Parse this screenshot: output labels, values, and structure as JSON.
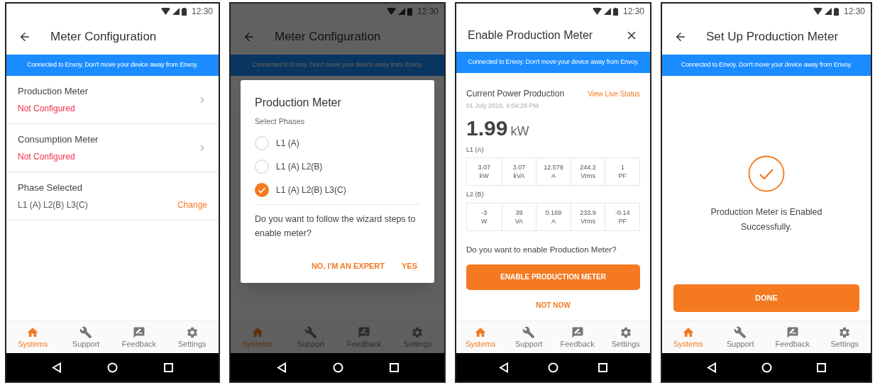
{
  "phones": [
    {
      "kind": "meters",
      "time": "12:30",
      "header": {
        "title": "Meter Configuration",
        "kind": "back"
      },
      "banner": "Connected to Envoy. Don't move your device away from Envoy.",
      "dimmed": false,
      "items": [
        {
          "title": "Production Meter",
          "status": "Not Configured"
        },
        {
          "title": "Consumption Meter",
          "status": "Not Configured"
        }
      ],
      "phase": {
        "title": "Phase Selected",
        "value": "L1 (A) L2(B) L3(C)",
        "action": "Change"
      },
      "tabs": [
        {
          "label": "Systems",
          "selected": true
        },
        {
          "label": "Support",
          "selected": false
        },
        {
          "label": "Feedback",
          "selected": false
        },
        {
          "label": "Settings",
          "selected": false
        }
      ]
    },
    {
      "kind": "dialog",
      "time": "12:30",
      "header": {
        "title": "Meter Configuration",
        "kind": "back"
      },
      "banner": "Connected to Envoy. Don't move your device away from Envoy.",
      "dimmed": true,
      "dialog": {
        "title": "Production Meter",
        "subtitle": "Select Phases",
        "options": [
          {
            "label": "L1 (A)",
            "selected": false
          },
          {
            "label": "L1 (A) L2(B)",
            "selected": false
          },
          {
            "label": "L1 (A) L2(B) L3(C)",
            "selected": true
          }
        ],
        "question": "Do you want to follow the wizard steps to enable meter?",
        "buttons": [
          "NO, I'M AN EXPERT",
          "YES"
        ]
      },
      "tabs": [
        {
          "label": "Systems",
          "selected": true
        },
        {
          "label": "Support",
          "selected": false
        },
        {
          "label": "Feedback",
          "selected": false
        },
        {
          "label": "Settings",
          "selected": false
        }
      ]
    },
    {
      "kind": "enable",
      "time": "12:30",
      "header": {
        "title": "Enable Production Meter",
        "kind": "close"
      },
      "banner": "Connected to Envoy. Don't move your device away from Envoy.",
      "dimmed": false,
      "power": {
        "title": "Current Power Production",
        "link": "View Live Status",
        "timestamp": "01 July 2019, 4:04:28 PM",
        "value": "1.99",
        "unit": "kW",
        "phases": [
          {
            "label": "L1 (A)",
            "cells": [
              {
                "value": "3.07",
                "unit": "kW"
              },
              {
                "value": "3.07",
                "unit": "kVA"
              },
              {
                "value": "12.579",
                "unit": "A"
              },
              {
                "value": "244.2",
                "unit": "Vrms"
              },
              {
                "value": "1",
                "unit": "PF"
              }
            ]
          },
          {
            "label": "L2 (B)",
            "cells": [
              {
                "value": "-3",
                "unit": "W"
              },
              {
                "value": "39",
                "unit": "VA"
              },
              {
                "value": "0.169",
                "unit": "A"
              },
              {
                "value": "233.9",
                "unit": "Vrms"
              },
              {
                "value": "-0.14",
                "unit": "PF"
              }
            ]
          }
        ]
      },
      "question": "Do you want to enable Production Meter?",
      "primary_button": "ENABLE PRODUCTION METER",
      "secondary_button": "NOT NOW",
      "tabs": [
        {
          "label": "Systems",
          "selected": true
        },
        {
          "label": "Support",
          "selected": false
        },
        {
          "label": "Feedback",
          "selected": false
        },
        {
          "label": "Settings",
          "selected": false
        }
      ]
    },
    {
      "kind": "success",
      "time": "12:30",
      "header": {
        "title": "Set Up Production Meter",
        "kind": "back"
      },
      "banner": "Connected to Envoy. Don't move your device away from Envoy.",
      "dimmed": false,
      "message": "Production Meter is Enabled Successfully.",
      "button": "DONE",
      "tabs": [
        {
          "label": "Systems",
          "selected": true
        },
        {
          "label": "Support",
          "selected": false
        },
        {
          "label": "Feedback",
          "selected": false
        },
        {
          "label": "Settings",
          "selected": false
        }
      ]
    }
  ]
}
